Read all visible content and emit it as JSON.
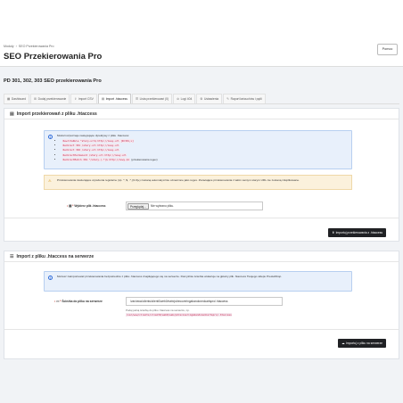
{
  "header": {
    "breadcrumb": [
      "Moduły",
      "SEO Przekierowania Pro"
    ],
    "title": "SEO Przekierowania Pro",
    "help_button": "Pomoc"
  },
  "module_title": "PD 301, 302, 303 SEO przekierowania Pro",
  "tabs": [
    {
      "label": "Dashboard",
      "icon": "dashboard-icon",
      "glyph": "▦",
      "active": false
    },
    {
      "label": "Dodaj przekierowanie",
      "icon": "add-icon",
      "glyph": "⊞",
      "active": false
    },
    {
      "label": "Import CSV",
      "icon": "upload-icon",
      "glyph": "⇪",
      "active": false
    },
    {
      "label": "Import .htaccess",
      "icon": "file-icon",
      "glyph": "▤",
      "active": true
    },
    {
      "label": "Lista przekierowań (0)",
      "icon": "list-icon",
      "glyph": "☰",
      "active": false
    },
    {
      "label": "Logi 404",
      "icon": "warning-icon",
      "glyph": "⊘",
      "active": false
    },
    {
      "label": "Ustawienia",
      "icon": "gear-icon",
      "glyph": "⚙",
      "active": false
    },
    {
      "label": "Raport łańcuchów i pętli",
      "icon": "wrench-icon",
      "glyph": "✎",
      "active": false
    }
  ],
  "htaccess_upload": {
    "title": "Import przekierowań z pliku .htaccess",
    "info_intro": "Moduł rozpoznaje następujące dyrektywy z pliku .htaccess:",
    "directives": [
      {
        "code": "RewriteRule ^stary-url$ http://nowy-url [R=301,L]",
        "suffix": ""
      },
      {
        "code": "Redirect 301 /stary-url http://nowy-url",
        "suffix": ""
      },
      {
        "code": "Redirect 302 /stary-url http://nowy-url",
        "suffix": ""
      },
      {
        "code": "RedirectPermanent /stary-url http://nowy-url",
        "suffix": ""
      },
      {
        "code": "RedirectMatch 301 ^/stary-(.*)$ http://nowy-$1",
        "suffix": "(przekierowania regex)"
      }
    ],
    "warning": "Przekierowania zawierające wyrażenia regularne (np. ^, $, .*, [0-9]+) zostaną automatycznie oznaczone jako regex. Zwracające przekierowania z takim samym starym URL nie zostaną zduplikowane.",
    "file_label": "Wybierz plik .htaccess",
    "file_button": "Przeglądaj...",
    "file_placeholder": "Nie wybrano pliku.",
    "submit": "Importuj przekierowania z .htaccess"
  },
  "server_import": {
    "title": "Import z pliku .htaccess na serwerze",
    "info": "Możesz zaimportować przekierowania bezpośrednio z pliku .htaccess znajdującego się na serwerze. Domyślnie ścieżka wskazuje na główny plik .htaccess Twojego sklepu PrestaShop.",
    "path_label": "Ścieżka do pliku na serwerze",
    "path_value": "/var/www/clients/client0/web0/web/pdrecoveringabandonedcartspro/.htaccess",
    "help_prefix": "Podaj pełną ścieżkę do pliku .htaccess na serwerze, np.",
    "help_code": "/var/www/clients/client0/web0/web/pdrecoveringabandonedcartspro/.htaccess",
    "submit": "Importuj z pliku na serwerze"
  }
}
